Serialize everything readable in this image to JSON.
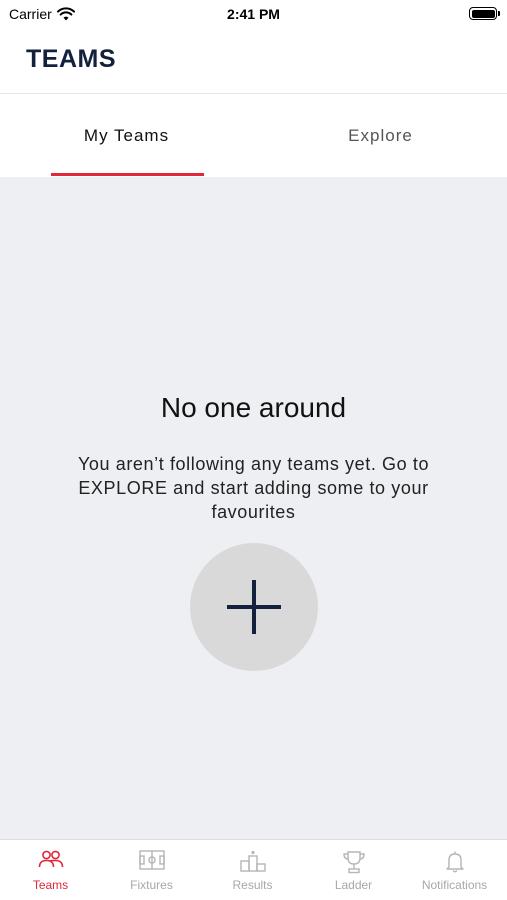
{
  "status_bar": {
    "carrier": "Carrier",
    "time": "2:41 PM",
    "wifi_icon": "wifi-icon",
    "battery_icon": "battery-icon"
  },
  "header": {
    "title": "TEAMS"
  },
  "tabs": [
    {
      "label": "My Teams",
      "active": true
    },
    {
      "label": "Explore",
      "active": false
    }
  ],
  "empty_state": {
    "title": "No one around",
    "message": "You aren’t following any teams yet. Go to EXPLORE and start adding some to your favourites",
    "add_icon": "plus-icon"
  },
  "bottom_nav": {
    "items": [
      {
        "label": "Teams",
        "icon": "teams-icon",
        "active": true
      },
      {
        "label": "Fixtures",
        "icon": "fixtures-icon",
        "active": false
      },
      {
        "label": "Results",
        "icon": "results-icon",
        "active": false
      },
      {
        "label": "Ladder",
        "icon": "ladder-icon",
        "active": false
      },
      {
        "label": "Notifications",
        "icon": "bell-icon",
        "active": false
      }
    ]
  },
  "colors": {
    "accent": "#e3273a",
    "brand_navy": "#14213d",
    "inactive": "#a8a8a8",
    "background": "#eeeff3"
  }
}
